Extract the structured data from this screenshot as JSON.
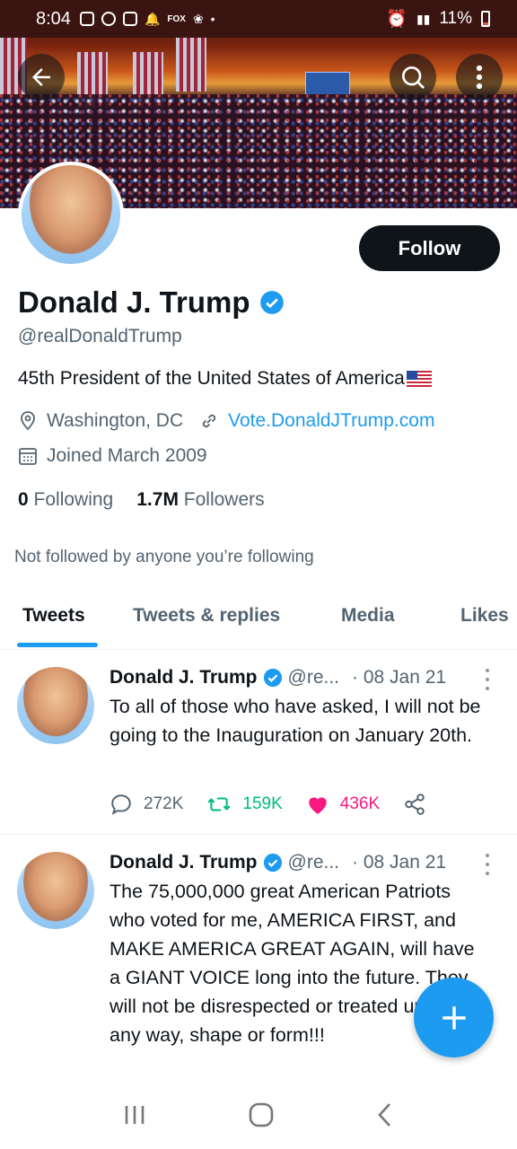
{
  "status_bar": {
    "time": "8:04",
    "battery": "11%",
    "icons": [
      "notification-icon",
      "gesture-icon",
      "instagram-icon",
      "bell-icon",
      "fox-sports-icon",
      "fan-icon",
      "dot-icon"
    ]
  },
  "header": {
    "back_icon": "arrow-left-icon",
    "search_icon": "search-icon",
    "more_icon": "more-vertical-icon"
  },
  "profile": {
    "follow_label": "Follow",
    "name": "Donald J. Trump",
    "handle": "@realDonaldTrump",
    "bio": "45th President of the United States of America",
    "location": "Washington, DC",
    "website": "Vote.DonaldJTrump.com",
    "joined": "Joined March 2009",
    "following_count": "0",
    "following_label": "Following",
    "followers_count": "1.7M",
    "followers_label": "Followers",
    "not_followed": "Not followed by anyone you’re following"
  },
  "tabs": [
    {
      "label": "Tweets",
      "active": true
    },
    {
      "label": "Tweets & replies",
      "active": false
    },
    {
      "label": "Media",
      "active": false
    },
    {
      "label": "Likes",
      "active": false
    }
  ],
  "tweets": [
    {
      "name": "Donald J. Trump",
      "handle": "@re...",
      "date": "· 08 Jan 21",
      "text": "To all of those who have asked, I will not be going to the Inauguration on January 20th.",
      "replies": "272K",
      "retweets": "159K",
      "likes": "436K"
    },
    {
      "name": "Donald J. Trump",
      "handle": "@re...",
      "date": "· 08 Jan 21",
      "text": "The 75,000,000 great American Patriots who voted for me, AMERICA FIRST, and MAKE AMERICA GREAT AGAIN, will have a GIANT VOICE long into the future. They will not be disrespected or treated unfairly in any way, shape or form!!!"
    }
  ],
  "colors": {
    "accent": "#1d9bf0",
    "text": "#0f1419",
    "muted": "#536471",
    "retweet": "#00ba7c",
    "like": "#f91880"
  }
}
